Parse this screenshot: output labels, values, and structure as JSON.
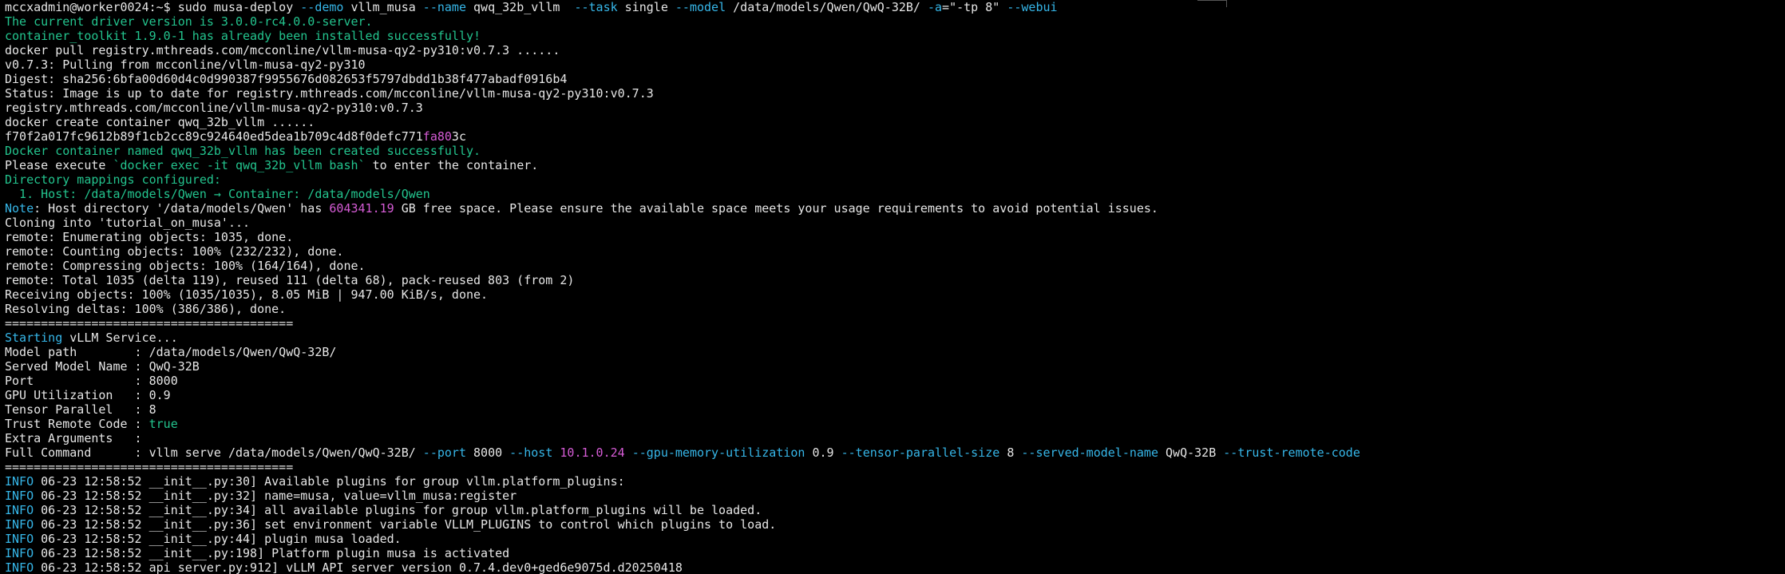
{
  "terminal": {
    "lines": [
      [
        {
          "t": "mccxadmin@worker0024:~$ sudo musa-deploy ",
          "c": "white"
        },
        {
          "t": "--demo",
          "c": "cyan"
        },
        {
          "t": " vllm_musa ",
          "c": "white"
        },
        {
          "t": "--name",
          "c": "cyan"
        },
        {
          "t": " qwq_32b_vllm  ",
          "c": "white"
        },
        {
          "t": "--task",
          "c": "cyan"
        },
        {
          "t": " single ",
          "c": "white"
        },
        {
          "t": "--model",
          "c": "cyan"
        },
        {
          "t": " /data/models/Qwen/QwQ-32B/ ",
          "c": "white"
        },
        {
          "t": "-a",
          "c": "cyan"
        },
        {
          "t": "=\"-tp 8\" ",
          "c": "white"
        },
        {
          "t": "--webui",
          "c": "cyan"
        }
      ],
      [
        {
          "t": "The current driver version is 3.0.0-rc4.0.0-server.",
          "c": "green"
        }
      ],
      [
        {
          "t": "container_toolkit 1.9.0-1 has already been installed successfully!",
          "c": "green"
        }
      ],
      [
        {
          "t": "docker pull registry.mthreads.com/mcconline/vllm-musa-qy2-py310:v0.7.3 ......",
          "c": "white"
        }
      ],
      [
        {
          "t": "v0.7.3: Pulling from mcconline/vllm-musa-qy2-py310",
          "c": "white"
        }
      ],
      [
        {
          "t": "Digest: sha256:6bfa00d60d4c0d990387f9955676d082653f5797dbdd1b38f477abadf0916b4",
          "c": "white"
        }
      ],
      [
        {
          "t": "Status: Image is up to date for registry.mthreads.com/mcconline/vllm-musa-qy2-py310:v0.7.3",
          "c": "white"
        }
      ],
      [
        {
          "t": "registry.mthreads.com/mcconline/vllm-musa-qy2-py310:v0.7.3",
          "c": "white"
        }
      ],
      [
        {
          "t": "docker create container qwq_32b_vllm ......",
          "c": "white"
        }
      ],
      [
        {
          "t": "f70f2a017fc9612b89f1cb2cc89c924640ed5dea1b709c4d8f0defc771",
          "c": "white"
        },
        {
          "t": "fa80",
          "c": "magenta"
        },
        {
          "t": "3c",
          "c": "white"
        }
      ],
      [
        {
          "t": "Docker container named qwq_32b_vllm has been created successfully.",
          "c": "green"
        }
      ],
      [
        {
          "t": "Please execute ",
          "c": "white"
        },
        {
          "t": "`docker exec -it qwq_32b_vllm bash`",
          "c": "green"
        },
        {
          "t": " to enter the container.",
          "c": "white"
        }
      ],
      [
        {
          "t": "Directory mappings configured:",
          "c": "green"
        }
      ],
      [
        {
          "t": "  1. Host: /data/models/Qwen → Container: /data/models/Qwen",
          "c": "green"
        }
      ],
      [
        {
          "t": "Note",
          "c": "cyan"
        },
        {
          "t": ": Host directory '/data/models/Qwen' has ",
          "c": "white"
        },
        {
          "t": "604341.19",
          "c": "magenta"
        },
        {
          "t": " GB free space. Please ensure the available space meets your usage requirements to avoid potential issues.",
          "c": "white"
        }
      ],
      [
        {
          "t": "Cloning into 'tutorial_on_musa'...",
          "c": "white"
        }
      ],
      [
        {
          "t": "remote: Enumerating objects: 1035, done.",
          "c": "white"
        }
      ],
      [
        {
          "t": "remote: Counting objects: 100% (232/232), done.",
          "c": "white"
        }
      ],
      [
        {
          "t": "remote: Compressing objects: 100% (164/164), done.",
          "c": "white"
        }
      ],
      [
        {
          "t": "remote: Total 1035 (delta 119), reused 111 (delta 68), pack-reused 803 (from 2)",
          "c": "white"
        }
      ],
      [
        {
          "t": "Receiving objects: 100% (1035/1035), 8.05 MiB | 947.00 KiB/s, done.",
          "c": "white"
        }
      ],
      [
        {
          "t": "Resolving deltas: 100% (386/386), done.",
          "c": "white"
        }
      ],
      [
        {
          "t": "========================================",
          "c": "white"
        }
      ],
      [
        {
          "t": "Starting",
          "c": "cyan"
        },
        {
          "t": " vLLM Service...",
          "c": "white"
        }
      ],
      [
        {
          "t": "Model path        : /data/models/Qwen/QwQ-32B/",
          "c": "white"
        }
      ],
      [
        {
          "t": "Served Model Name : QwQ-32B",
          "c": "white"
        }
      ],
      [
        {
          "t": "Port              : 8000",
          "c": "white"
        }
      ],
      [
        {
          "t": "GPU Utilization   : 0.9",
          "c": "white"
        }
      ],
      [
        {
          "t": "Tensor Parallel   : 8",
          "c": "white"
        }
      ],
      [
        {
          "t": "Trust Remote Code : ",
          "c": "white"
        },
        {
          "t": "true",
          "c": "green"
        }
      ],
      [
        {
          "t": "Extra Arguments   :",
          "c": "white"
        }
      ],
      [
        {
          "t": "Full Command      : vllm serve /data/models/Qwen/QwQ-32B/ ",
          "c": "white"
        },
        {
          "t": "--port",
          "c": "cyan"
        },
        {
          "t": " 8000 ",
          "c": "white"
        },
        {
          "t": "--host",
          "c": "cyan"
        },
        {
          "t": " ",
          "c": "white"
        },
        {
          "t": "10.1.0.24",
          "c": "magenta"
        },
        {
          "t": " ",
          "c": "white"
        },
        {
          "t": "--gpu-memory-utilization",
          "c": "cyan"
        },
        {
          "t": " 0.9 ",
          "c": "white"
        },
        {
          "t": "--tensor-parallel-size",
          "c": "cyan"
        },
        {
          "t": " 8 ",
          "c": "white"
        },
        {
          "t": "--served-model-name",
          "c": "cyan"
        },
        {
          "t": " QwQ-32B ",
          "c": "white"
        },
        {
          "t": "--trust-remote-code",
          "c": "cyan"
        }
      ],
      [
        {
          "t": "========================================",
          "c": "white"
        }
      ],
      [
        {
          "t": "INFO",
          "c": "cyan"
        },
        {
          "t": " 06-23 12:58:52 __init__.py:30] Available plugins for group vllm.platform_plugins:",
          "c": "white"
        }
      ],
      [
        {
          "t": "INFO",
          "c": "cyan"
        },
        {
          "t": " 06-23 12:58:52 __init__.py:32] name=musa, value=vllm_musa:register",
          "c": "white"
        }
      ],
      [
        {
          "t": "INFO",
          "c": "cyan"
        },
        {
          "t": " 06-23 12:58:52 __init__.py:34] all available plugins for group vllm.platform_plugins will be loaded.",
          "c": "white"
        }
      ],
      [
        {
          "t": "INFO",
          "c": "cyan"
        },
        {
          "t": " 06-23 12:58:52 __init__.py:36] set environment variable VLLM_PLUGINS to control which plugins to load.",
          "c": "white"
        }
      ],
      [
        {
          "t": "INFO",
          "c": "cyan"
        },
        {
          "t": " 06-23 12:58:52 __init__.py:44] plugin musa loaded.",
          "c": "white"
        }
      ],
      [
        {
          "t": "INFO",
          "c": "cyan"
        },
        {
          "t": " 06-23 12:58:52 __init__.py:198] Platform plugin musa is activated",
          "c": "white"
        }
      ],
      [
        {
          "t": "INFO",
          "c": "cyan"
        },
        {
          "t": " 06-23 12:58:52 api_server.py:912] vLLM API server version 0.7.4.dev0+ged6e9075d.d20250418",
          "c": "white"
        }
      ]
    ]
  }
}
